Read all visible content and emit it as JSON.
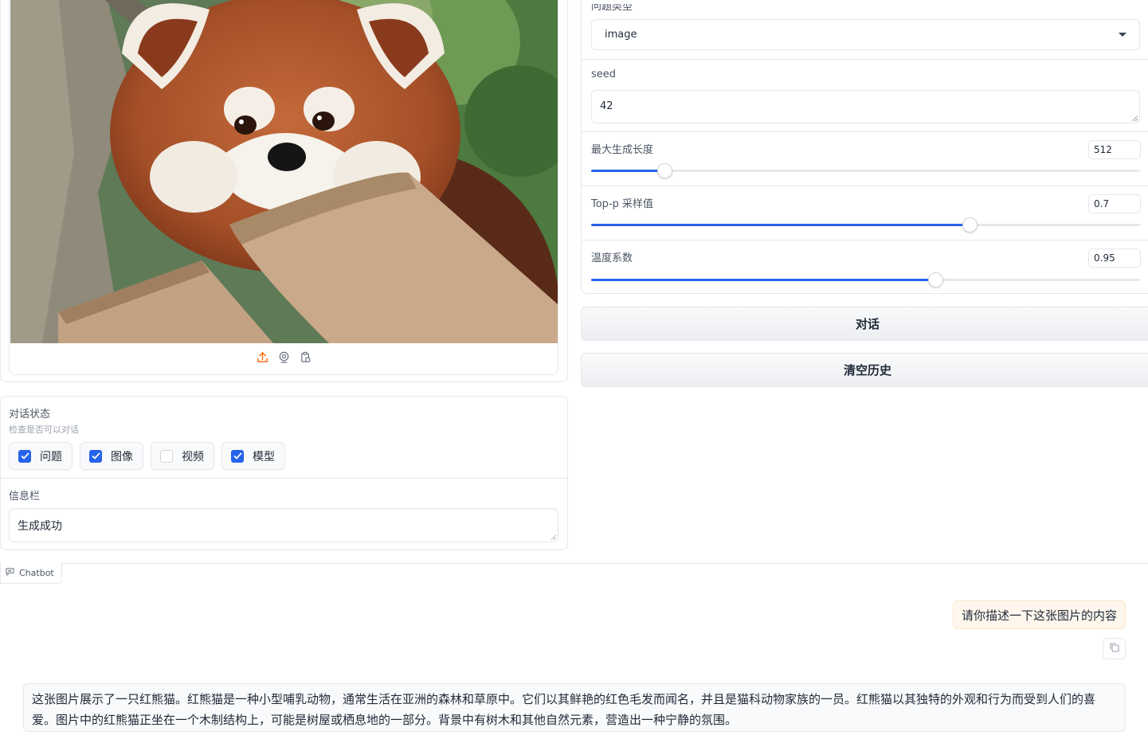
{
  "image_panel": {
    "tools": [
      "upload-icon",
      "webcam-icon",
      "clipboard-icon"
    ],
    "accent_color": "#f97316"
  },
  "status": {
    "label": "对话状态",
    "info": "检查是否可以对话",
    "checkboxes": [
      {
        "label": "问题",
        "checked": true
      },
      {
        "label": "图像",
        "checked": true
      },
      {
        "label": "视频",
        "checked": false
      },
      {
        "label": "模型",
        "checked": true
      }
    ]
  },
  "info_bar": {
    "label": "信息栏",
    "value": "生成成功"
  },
  "settings": {
    "question_type": {
      "label": "问题类型",
      "value": "image"
    },
    "seed": {
      "label": "seed",
      "value": "42"
    },
    "max_length": {
      "label": "最大生成长度",
      "value": "512",
      "fraction": 0.133
    },
    "top_p": {
      "label": "Top-p 采样值",
      "value": "0.7",
      "fraction": 0.69
    },
    "temperature": {
      "label": "温度系数",
      "value": "0.95",
      "fraction": 0.627
    },
    "accent_color": "#2563eb"
  },
  "buttons": {
    "chat": "对话",
    "clear": "清空历史"
  },
  "chatbot": {
    "label": "Chatbot",
    "messages": [
      {
        "role": "user",
        "text": "请你描述一下这张图片的内容"
      },
      {
        "role": "bot",
        "text": "这张图片展示了一只红熊猫。红熊猫是一种小型哺乳动物，通常生活在亚洲的森林和草原中。它们以其鲜艳的红色毛发而闻名，并且是猫科动物家族的一员。红熊猫以其独特的外观和行为而受到人们的喜爱。图片中的红熊猫正坐在一个木制结构上，可能是树屋或栖息地的一部分。背景中有树木和其他自然元素，营造出一种宁静的氛围。"
      }
    ]
  }
}
